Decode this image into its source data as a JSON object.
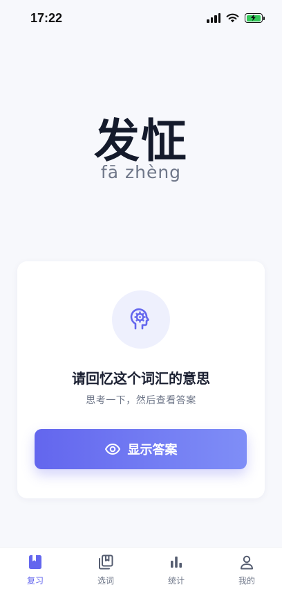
{
  "status_bar": {
    "time": "17:22"
  },
  "word": {
    "hanzi": "发怔",
    "pinyin": "fā zhèng"
  },
  "card": {
    "title": "请回忆这个词汇的意思",
    "subtitle": "思考一下，然后查看答案",
    "show_answer_label": "显示答案"
  },
  "tabs": [
    {
      "label": "复习",
      "icon": "book-icon",
      "active": true
    },
    {
      "label": "选词",
      "icon": "cards-stack-icon",
      "active": false
    },
    {
      "label": "统计",
      "icon": "bar-chart-icon",
      "active": false
    },
    {
      "label": "我的",
      "icon": "user-icon",
      "active": false
    }
  ],
  "colors": {
    "accent": "#6366ee",
    "accent_light": "#eef0fd",
    "text_primary": "#1b2032",
    "text_secondary": "#6f7789",
    "battery_green": "#34c759"
  }
}
